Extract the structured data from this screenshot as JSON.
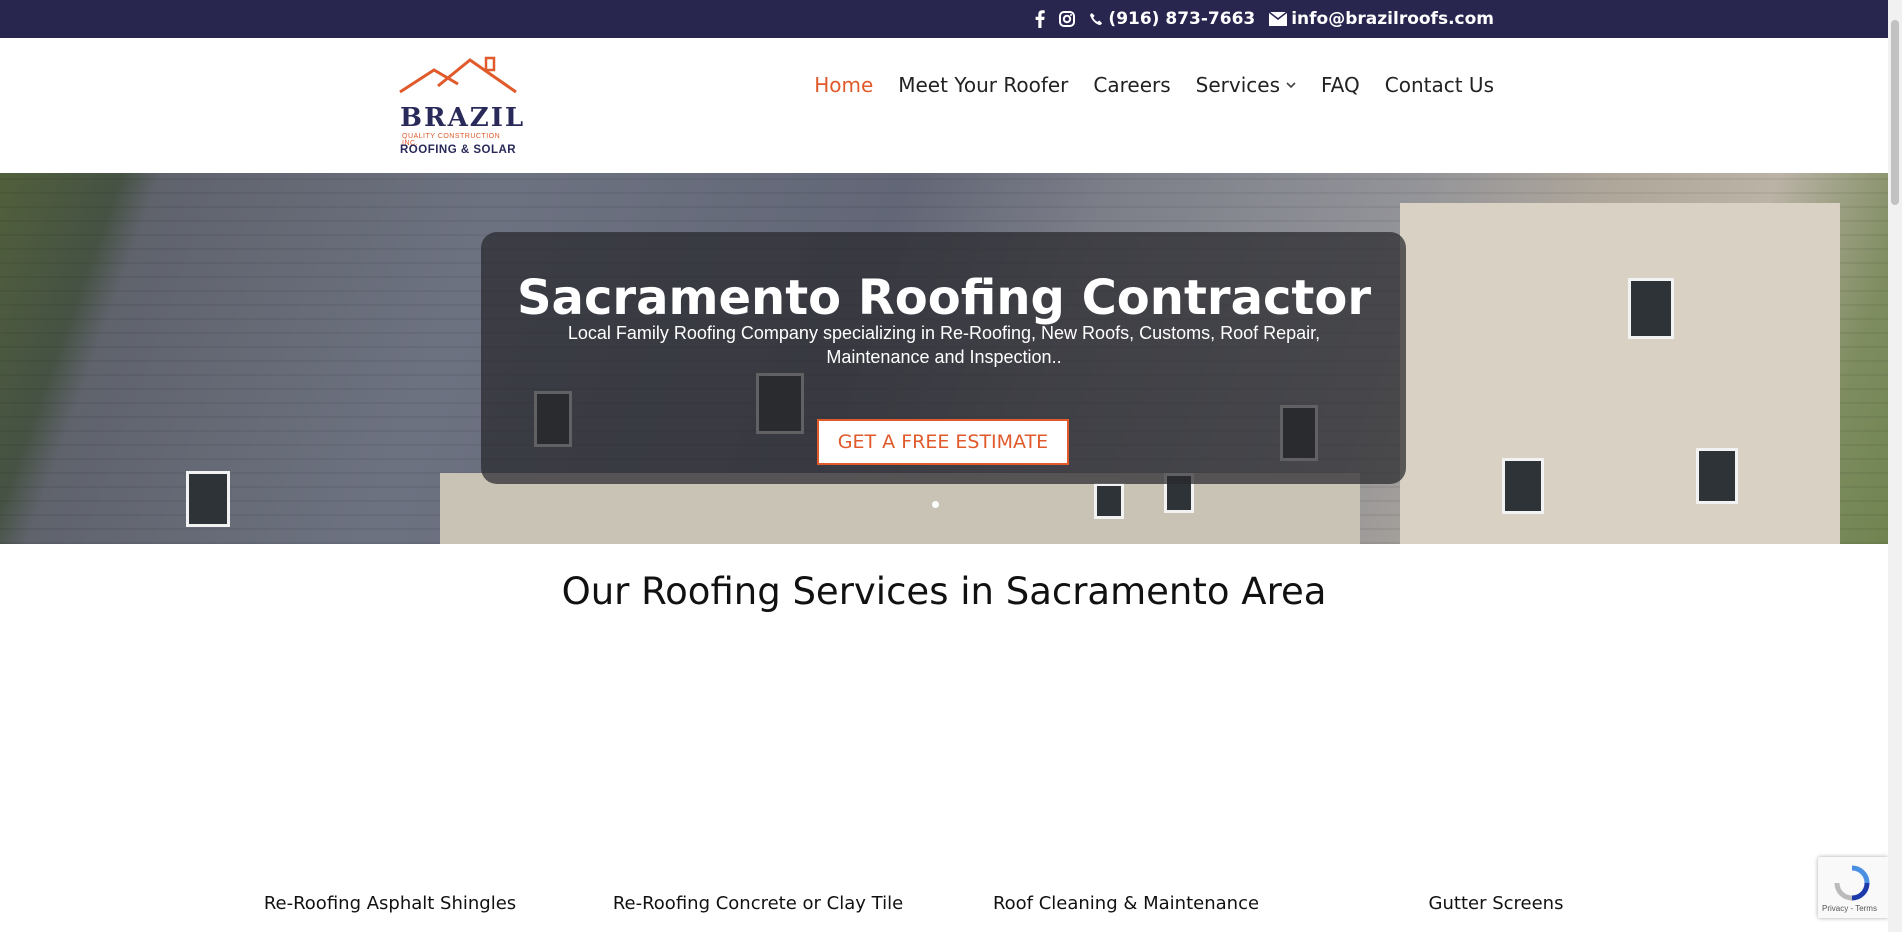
{
  "topbar": {
    "phone": "(916) 873-7663",
    "email": "info@brazilroofs.com",
    "icons": [
      "facebook-icon",
      "instagram-icon",
      "phone-icon",
      "envelope-icon"
    ]
  },
  "logo": {
    "brand": "BRAZIL",
    "sub1": "QUALITY CONSTRUCTION INC.",
    "sub2": "ROOFING & SOLAR"
  },
  "nav": {
    "items": [
      {
        "label": "Home",
        "active": true
      },
      {
        "label": "Meet Your Roofer"
      },
      {
        "label": "Careers"
      },
      {
        "label": "Services",
        "has_dropdown": true
      },
      {
        "label": "FAQ"
      },
      {
        "label": "Contact Us"
      }
    ]
  },
  "hero": {
    "title": "Sacramento Roofing Contractor",
    "tagline": "Local Family Roofing Company specializing in Re-Roofing, New Roofs, Customs, Roof Repair, Maintenance and Inspection..",
    "cta": "GET A FREE ESTIMATE"
  },
  "services": {
    "title": "Our Roofing Services in Sacramento Area",
    "items": [
      "Re-Roofing Asphalt Shingles",
      "Re-Roofing Concrete or Clay Tile",
      "Roof Cleaning & Maintenance",
      "Gutter Screens"
    ]
  },
  "recaptcha": {
    "text": "Privacy - Terms"
  },
  "colors": {
    "navy": "#28254f",
    "accent": "#e05a2b"
  }
}
